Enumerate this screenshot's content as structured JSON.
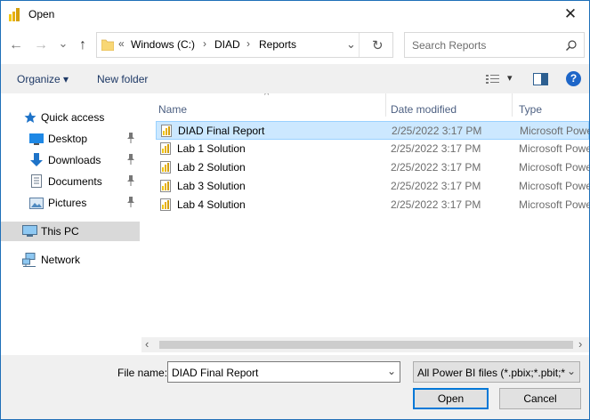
{
  "window": {
    "title": "Open",
    "close_glyph": "✕"
  },
  "nav": {
    "back_glyph": "←",
    "forward_glyph": "→",
    "recent_glyph": "⌄",
    "up_glyph": "↑",
    "breadcrumb_prefix": "«",
    "breadcrumb": [
      "Windows (C:)",
      "DIAD",
      "Reports"
    ],
    "separator": "›",
    "dropdown_glyph": "⌄",
    "refresh_glyph": "↻",
    "search_placeholder": "Search Reports"
  },
  "toolbar": {
    "organize_label": "Organize ▾",
    "new_folder_label": "New folder",
    "view_arrow": "▾",
    "help_glyph": "?"
  },
  "sidebar": {
    "quick_access": "Quick access",
    "items": [
      {
        "label": "Desktop",
        "icon": "desktop-icon"
      },
      {
        "label": "Downloads",
        "icon": "download-icon"
      },
      {
        "label": "Documents",
        "icon": "documents-icon"
      },
      {
        "label": "Pictures",
        "icon": "pictures-icon"
      }
    ],
    "this_pc": "This PC",
    "network": "Network"
  },
  "columns": {
    "sort_glyph": "^",
    "name": "Name",
    "date": "Date modified",
    "type": "Type"
  },
  "files": [
    {
      "name": "DIAD Final Report",
      "date": "2/25/2022 3:17 PM",
      "type": "Microsoft Power BI"
    },
    {
      "name": "Lab 1 Solution",
      "date": "2/25/2022 3:17 PM",
      "type": "Microsoft Power BI"
    },
    {
      "name": "Lab 2 Solution",
      "date": "2/25/2022 3:17 PM",
      "type": "Microsoft Power BI"
    },
    {
      "name": "Lab 3 Solution",
      "date": "2/25/2022 3:17 PM",
      "type": "Microsoft Power BI"
    },
    {
      "name": "Lab 4 Solution",
      "date": "2/25/2022 3:17 PM",
      "type": "Microsoft Power BI"
    }
  ],
  "scroll": {
    "left_glyph": "‹",
    "right_glyph": "›"
  },
  "footer": {
    "file_name_label": "File name:",
    "file_name_value": "DIAD Final Report",
    "file_name_arrow": "⌄",
    "filter_value": "All Power BI files (*.pbix;*.pbit;*",
    "filter_arrow": "⌄",
    "open_label": "Open",
    "cancel_label": "Cancel"
  },
  "colors": {
    "accent": "#0078d7",
    "selection": "#cce8ff",
    "folder": "#f8d775",
    "pbi_yellow": "#f2c811"
  }
}
